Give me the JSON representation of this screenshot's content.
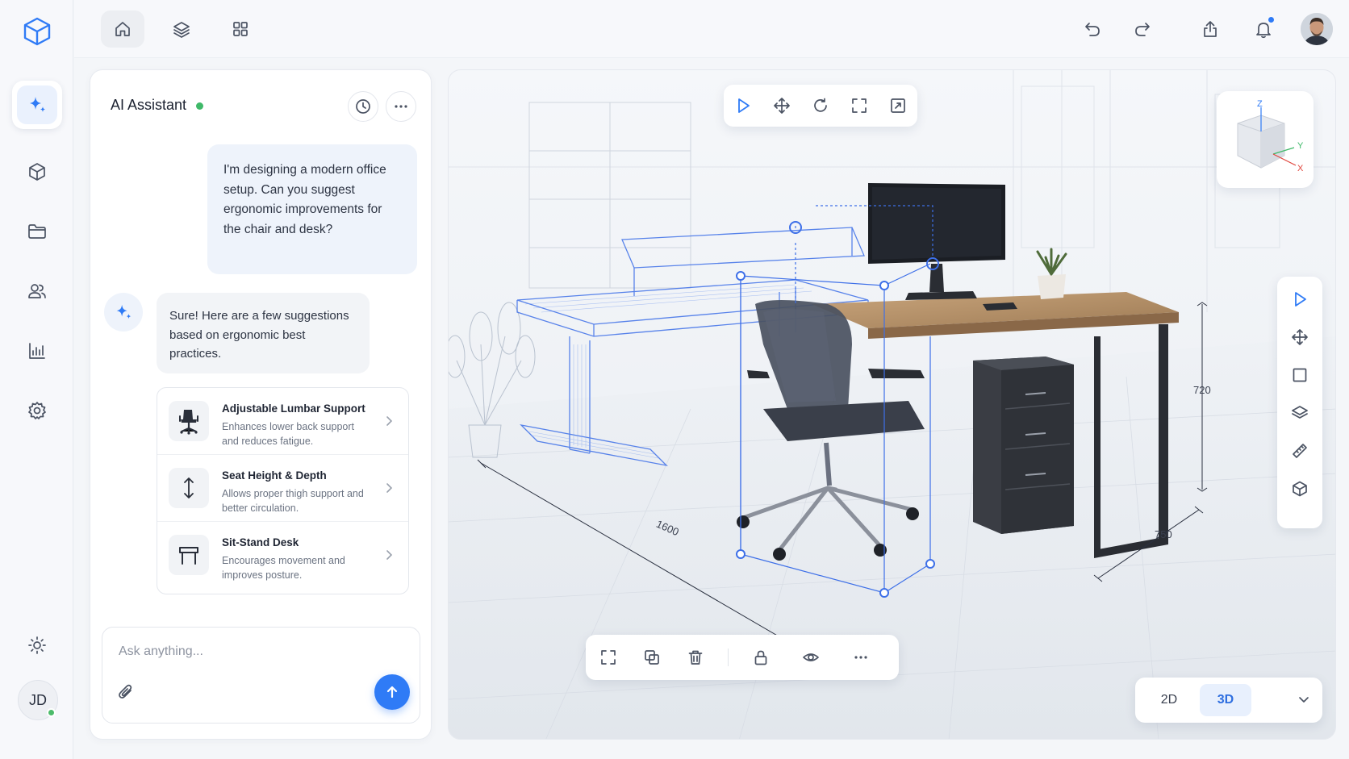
{
  "rail": {
    "items": [
      {
        "name": "ai-assistant",
        "icon": "sparkle-icon"
      },
      {
        "name": "models",
        "icon": "cube-icon"
      },
      {
        "name": "files",
        "icon": "folder-icon"
      },
      {
        "name": "team",
        "icon": "users-icon"
      },
      {
        "name": "analytics",
        "icon": "chart-icon"
      },
      {
        "name": "settings",
        "icon": "gear-icon"
      }
    ],
    "user_initials": "JD"
  },
  "topbar": {
    "icons": [
      "home-icon",
      "layers-icon",
      "grid-icon",
      "undo-icon",
      "redo-icon",
      "share-icon",
      "bell-icon"
    ]
  },
  "chat": {
    "title": "AI Assistant",
    "user_message": "I'm designing a modern office setup. Can you suggest ergonomic improvements for the chair and desk?",
    "ai_message": "Sure! Here are a few suggestions based on ergonomic best practices.",
    "suggestions": [
      {
        "title": "Adjustable Lumbar Support",
        "desc": "Enhances lower back support and reduces fatigue.",
        "icon": "office-chair-icon"
      },
      {
        "title": "Seat Height & Depth",
        "desc": "Allows proper thigh support and better circulation.",
        "icon": "height-arrow-icon"
      },
      {
        "title": "Sit-Stand Desk",
        "desc": "Encourages movement and improves posture.",
        "icon": "desk-icon"
      }
    ],
    "composer_placeholder": "Ask anything..."
  },
  "viewport": {
    "top_tools": [
      "select-icon",
      "move-icon",
      "rotate-icon",
      "fit-view-icon",
      "frame-icon"
    ],
    "axis_labels": {
      "z": "Z",
      "y": "Y",
      "x": "X"
    },
    "side_tools": [
      "select-icon",
      "move-icon",
      "rectangle-icon",
      "layers-icon",
      "measure-icon",
      "box-icon"
    ],
    "dimensions": {
      "height": "720",
      "width": "1600",
      "depth": "750"
    },
    "bottom_tools": [
      "frame-select-icon",
      "duplicate-icon",
      "delete-icon",
      "lock-icon",
      "visibility-icon",
      "more-icon"
    ],
    "mode": {
      "options": [
        "2D",
        "3D"
      ],
      "selected": "3D"
    }
  },
  "colors": {
    "accent": "#2f7bf6",
    "online": "#3fb969",
    "wireframe": "#3d6fe8"
  }
}
